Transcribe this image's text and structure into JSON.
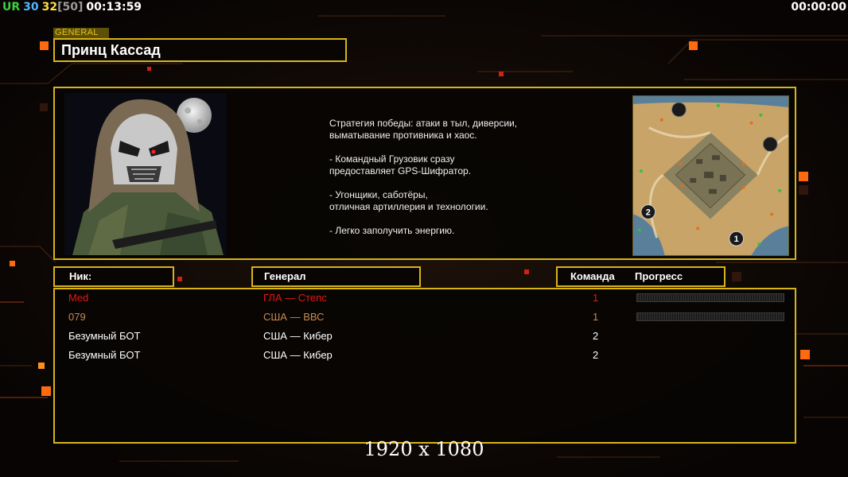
{
  "hud": {
    "ur_label": "UR",
    "fps": "30",
    "fps_target": "32",
    "fps_limit": "[50]",
    "elapsed_time": "00:13:59",
    "game_time": "00:00:00"
  },
  "general": {
    "tag": "GENERAL",
    "name": "Принц Кассад",
    "description": "Стратегия победы: атаки в тыл, диверсии,\n выматывание противника и хаос.\n\n- Командный Грузовик сразу\nпредоставляет GPS-Шифратор.\n\n- Угонщики, саботёры,\nотличная артиллерия и технологии.\n\n- Легко заполучить энергию."
  },
  "minimap": {
    "start_markers": [
      "2",
      "1"
    ]
  },
  "table": {
    "headers": {
      "nick": "Ник:",
      "general": "Генерал",
      "team": "Команда",
      "progress": "Прогресс"
    },
    "players": [
      {
        "nick": "Med",
        "general": "ГЛА — Степс",
        "team": "1",
        "color": "#e01818",
        "has_progress": true
      },
      {
        "nick": "079",
        "general": "США — ВВС",
        "team": "1",
        "color": "#c98a4e",
        "has_progress": true
      },
      {
        "nick": "Безумный БОТ",
        "general": "США — Кибер",
        "team": "2",
        "color": "#ffffff",
        "has_progress": false
      },
      {
        "nick": "Безумный БОТ",
        "general": "США — Кибер",
        "team": "2",
        "color": "#ffffff",
        "has_progress": false
      }
    ]
  },
  "resolution": "1920 x 1080",
  "colors": {
    "frame": "#d8b41a",
    "accent_orange": "#ff6a10",
    "ur": "#3dd13d",
    "fps": "#4fb8ff",
    "fps_target": "#ffe040",
    "fps_limit": "#9a9a9a"
  }
}
